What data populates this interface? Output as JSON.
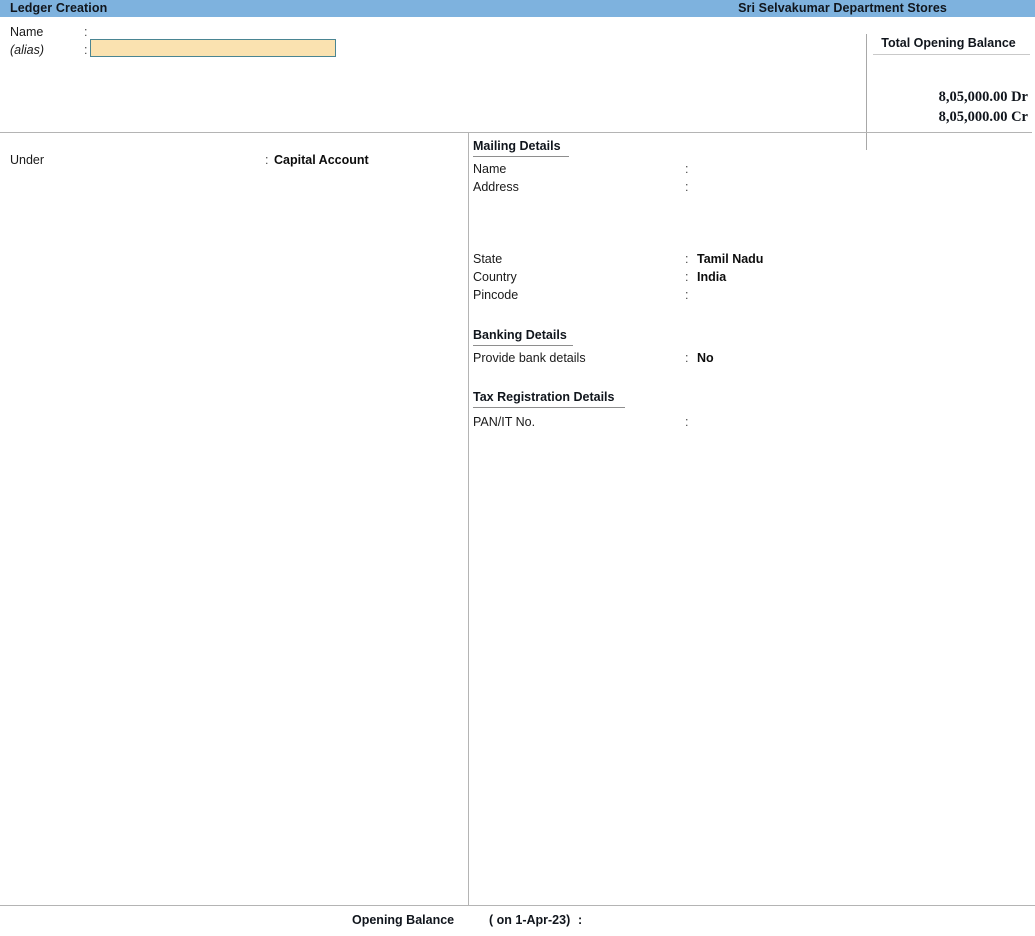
{
  "titlebar": {
    "screen_title": "Ledger Creation",
    "company_name": "Sri Selvakumar Department Stores"
  },
  "form": {
    "name_label": "Name",
    "name_value": "",
    "name_placeholder": "",
    "alias_label": "(alias)",
    "alias_value": "",
    "under_label": "Under",
    "under_value": "Capital Account",
    "colon": ":"
  },
  "totals": {
    "heading": "Total Opening Balance",
    "debit": "8,05,000.00 Dr",
    "credit": "8,05,000.00 Cr"
  },
  "mailing": {
    "heading": "Mailing Details",
    "rows": [
      {
        "label": "Name",
        "value": ""
      },
      {
        "label": "Address",
        "value": ""
      },
      {
        "label": "State",
        "value": "Tamil Nadu"
      },
      {
        "label": "Country",
        "value": "India"
      },
      {
        "label": "Pincode",
        "value": ""
      }
    ]
  },
  "banking": {
    "heading": "Banking Details",
    "rows": [
      {
        "label": "Provide bank details",
        "value": "No"
      }
    ]
  },
  "tax": {
    "heading": "Tax Registration Details",
    "rows": [
      {
        "label": "PAN/IT No.",
        "value": ""
      }
    ]
  },
  "footer": {
    "opening_balance_label": "Opening Balance",
    "as_on": "( on 1-Apr-23)",
    "colon": ":",
    "value": ""
  },
  "colors": {
    "titlebar_blue": "#7eb2de",
    "input_fill": "#fae2b0",
    "input_border": "#4a8592",
    "rule": "#b4b4b4"
  }
}
